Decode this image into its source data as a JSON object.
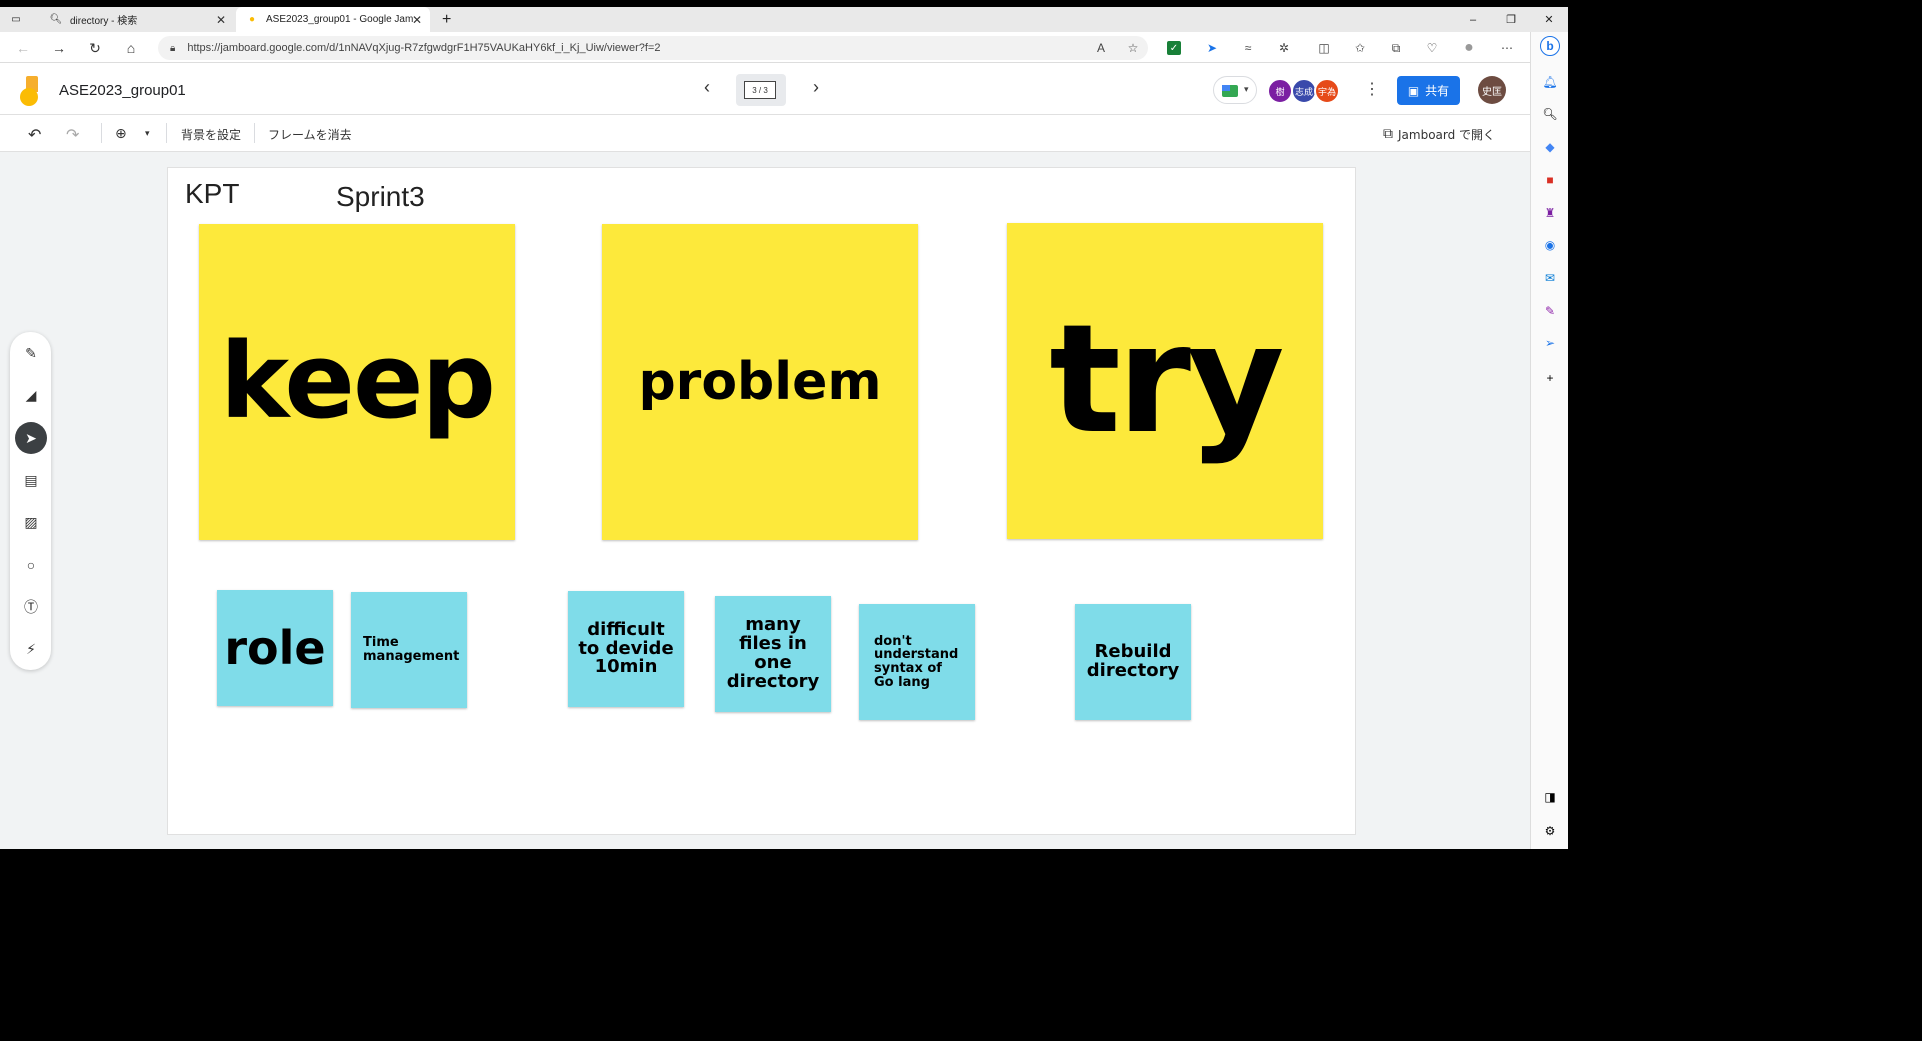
{
  "browser": {
    "tabs": [
      {
        "title": "directory - 検索",
        "icon": "search-icon"
      },
      {
        "title": "ASE2023_group01 - Google Jam",
        "icon": "jamboard-icon"
      }
    ],
    "new_tab": "+",
    "url": "https://jamboard.google.com/d/1nNAVqXjug-R7zfgwdgrF1H75VAUKaHY6kf_i_Kj_Uiw/viewer?f=2",
    "window_controls": {
      "minimize": "–",
      "restore": "❐",
      "close": "✕"
    }
  },
  "app": {
    "title": "ASE2023_group01",
    "frame_counter": "3 / 3",
    "share_label": "共有",
    "avatars": [
      {
        "label": "樹",
        "color": "#7b1fa2"
      },
      {
        "label": "志成",
        "color": "#3949ab"
      },
      {
        "label": "宇為",
        "color": "#e64a19"
      }
    ],
    "user_avatar": "史匡",
    "toolbar": {
      "set_background": "背景を設定",
      "clear_frame": "フレームを消去",
      "open_in_jamboard": "Jamboard で開く"
    }
  },
  "canvas": {
    "headings": {
      "kpt": "KPT",
      "sprint": "Sprint3"
    },
    "big_notes": [
      {
        "text": "keep"
      },
      {
        "text": "problem"
      },
      {
        "text": "try"
      }
    ],
    "small_notes": [
      {
        "text": "role"
      },
      {
        "text": "Time management"
      },
      {
        "text": "difficult to devide 10min"
      },
      {
        "text": "many files in one directory"
      },
      {
        "text": "don't understand syntax of Go lang"
      },
      {
        "text": "Rebuild directory"
      }
    ]
  },
  "colors": {
    "yellow_note": "#fde93b",
    "cyan_note": "#7fdce9",
    "share_button": "#1a73e8"
  }
}
